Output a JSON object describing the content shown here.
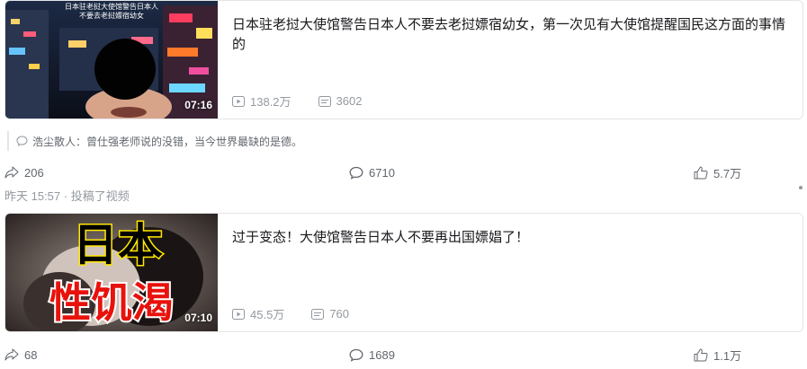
{
  "posts": [
    {
      "thumb_overlay_line1": "日本驻老挝大使馆警告日本人",
      "thumb_overlay_line2": "不要去老挝嫖宿幼女",
      "duration": "07:16",
      "title": "日本驻老挝大使馆警告日本人不要去老挝嫖宿幼女，第一次见有大使馆提醒国民这方面的事情的",
      "plays": "138.2万",
      "danmaku": "3602",
      "forwards": "206",
      "comments": "6710",
      "likes": "5.7万"
    },
    {
      "thumb_big_text1": "日本",
      "thumb_big_text2": "性饥渴",
      "duration": "07:10",
      "title": "过于变态！大使馆警告日本人不要再出国嫖娼了！",
      "plays": "45.5万",
      "danmaku": "760",
      "forwards": "68",
      "comments": "1689",
      "likes": "1.1万"
    }
  ],
  "hot_comment": {
    "author": "浩尘散人：",
    "text": "曾仕强老师说的没错，当今世界最缺的是德。"
  },
  "post2_meta": {
    "time": "昨天 15:57",
    "action": "投稿了视频"
  },
  "colors": {
    "text_primary": "#18191c",
    "text_secondary": "#9499a0",
    "border": "#e3e5e7",
    "thumb2_red": "#e8120c",
    "thumb2_yellow": "#ffe600"
  }
}
